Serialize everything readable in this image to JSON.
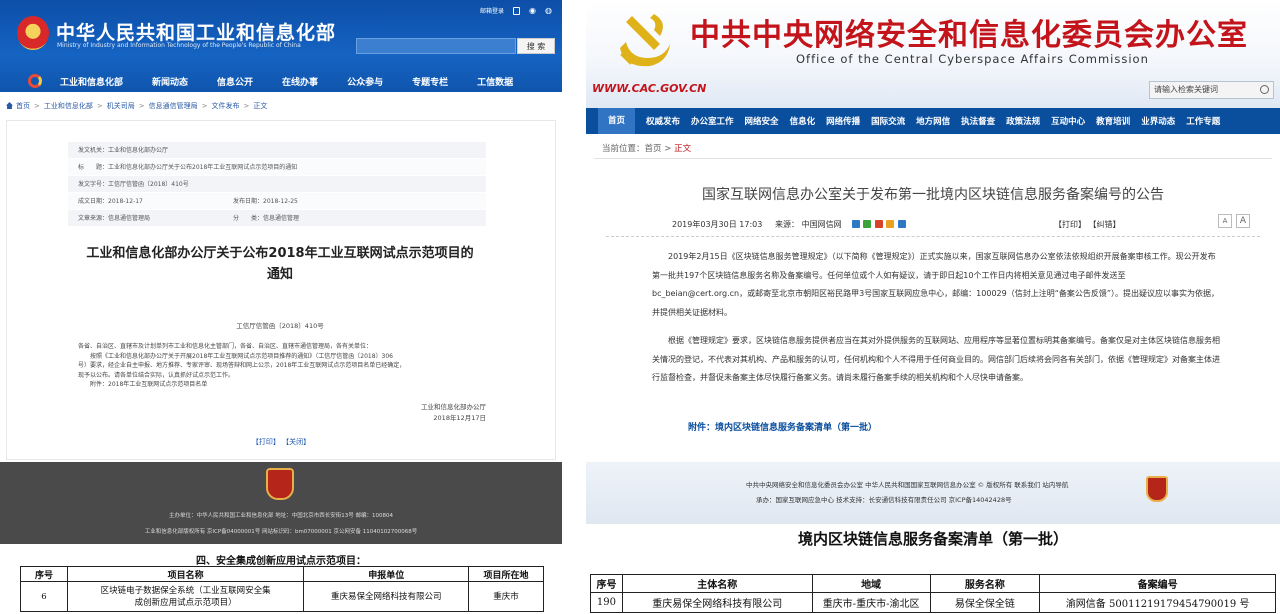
{
  "left": {
    "site_title": "中华人民共和国工业和信息化部",
    "site_subtitle": "Ministry of Industry and Information Technology of the People's Republic of China",
    "top_link": "邮箱登录",
    "search_button": "搜 索",
    "nav": [
      "工业和信息化部",
      "新闻动态",
      "信息公开",
      "在线办事",
      "公众参与",
      "专题专栏",
      "工信数据"
    ],
    "breadcrumb": [
      "首页",
      "工业和信息化部",
      "机关司局",
      "信息通信管理局",
      "文件发布",
      "正文"
    ],
    "meta": {
      "issuer": "发文机关：工业和信息化部办公厅",
      "subject": "标　　题：工业和信息化部办公厅关于公布2018年工业互联网试点示范项目的通知",
      "doc_no": "发文字号：工信厅信管函〔2018〕410号",
      "created": "成文日期：2018-12-17",
      "published": "发布日期：2018-12-25",
      "category": "文章来源：信息通信管理局",
      "class": "分　　类：信息通信管理"
    },
    "doc_title_1": "工业和信息化部办公厅关于公布2018年工业互联网试点示范项目的",
    "doc_title_2": "通知",
    "doc_number": "工信厅信管函〔2018〕410号",
    "body": [
      "各省、自治区、直辖市及计划单列市工业和信息化主管部门，各省、自治区、直辖市通信管理局，各有关单位：",
      "　　按照《工业和信息化部办公厅关于开展2018年工业互联网试点示范项目推荐的通知》（工信厅信管函〔2018〕306",
      "号）要求，经企业自主申报、地方推荐、专家评审、现场答辩和网上公示，2018年工业互联网试点示范项目名单已经确定，",
      "现予以公布。请各单位结合实际，认真抓好试点示范工作。",
      "　　附件：2018年工业互联网试点示范项目名单"
    ],
    "sign_org": "工业和信息化部办公厅",
    "sign_date": "2018年12月17日",
    "print_links": "【打印】 【关闭】",
    "footer_1": "主办单位：中华人民共和国工业和信息化部  地址：中国北京市西长安街13号  邮编：100804",
    "footer_2": "工业和信息化部版权所有  京ICP备04000001号  网站标识码：bm07000001    京公网安备 11040102700068号",
    "section_title": "四、安全集成创新应用试点示范项目：",
    "table": {
      "headers": [
        "序号",
        "项目名称",
        "申报单位",
        "项目所在地"
      ],
      "rows": [
        {
          "no": "6",
          "name_1": "区块链电子数据保全系统（工业互联网安全集",
          "name_2": "成创新应用试点示范项目）",
          "org": "重庆易保全网络科技有限公司",
          "loc": "重庆市"
        }
      ]
    }
  },
  "right": {
    "site_title": "中共中央网络安全和信息化委员会办公室",
    "site_subtitle": "Office of the Central Cyberspace Affairs Commission",
    "url": "WWW.CAC.GOV.CN",
    "search_placeholder": "请输入检索关键词",
    "nav": [
      "首页",
      "权威发布",
      "办公室工作",
      "网络安全",
      "信息化",
      "网络传播",
      "国际交流",
      "地方网信",
      "执法督查",
      "政策法规",
      "互动中心",
      "教育培训",
      "业界动态",
      "工作专题"
    ],
    "breadcrumb_prefix": "当前位置：",
    "breadcrumb_home": "首页",
    "breadcrumb_current": "正文",
    "article_title": "国家互联网信息办公室关于发布第一批境内区块链信息服务备案编号的公告",
    "date": "2019年03月30日 17:03",
    "source": "来源： 中国网信网",
    "print_links": "【打印】 【纠错】",
    "font_small": "A",
    "font_large": "A",
    "para_1": "2019年2月15日《区块链信息服务管理规定》（以下简称《管理规定》）正式实施以来，国家互联网信息办公室依法依规组织开展备案审核工作。现公开发布第一批共197个区块链信息服务名称及备案编号。任何单位或个人如有疑议，请于即日起10个工作日内将相关意见通过电子邮件发送至bc_beian@cert.org.cn，或邮寄至北京市朝阳区裕民路甲3号国家互联网应急中心，邮编：100029（信封上注明“备案公告反馈”）。提出疑议应以事实为依据，并提供相关证据材料。",
    "para_2": "根据《管理规定》要求，区块链信息服务提供者应当在其对外提供服务的互联网站、应用程序等显著位置标明其备案编号。备案仅是对主体区块链信息服务相关情况的登记，不代表对其机构、产品和服务的认可，任何机构和个人不得用于任何商业目的。网信部门后续将会同各有关部门，依据《管理规定》对备案主体进行监督检查，并督促未备案主体尽快履行备案义务。请尚未履行备案手续的相关机构和个人尽快申请备案。",
    "attachment": "附件：境内区块链信息服务备案清单（第一批）",
    "footer_1": "中共中央网络安全和信息化委员会办公室  中华人民共和国国家互联网信息办公室 © 版权所有  联系我们  站内导航",
    "footer_2": "承办：国家互联网应急中心  技术支持：长安通信科技有限责任公司  京ICP备14042428号",
    "section_title": "境内区块链信息服务备案清单（第一批）",
    "table": {
      "headers": [
        "序号",
        "主体名称",
        "地域",
        "服务名称",
        "备案编号"
      ],
      "rows": [
        {
          "no": "190",
          "name": "重庆易保全网络科技有限公司",
          "region": "重庆市-重庆市-渝北区",
          "service": "易保全保全链",
          "code": "渝网信备 50011219179454790019 号"
        }
      ]
    }
  }
}
